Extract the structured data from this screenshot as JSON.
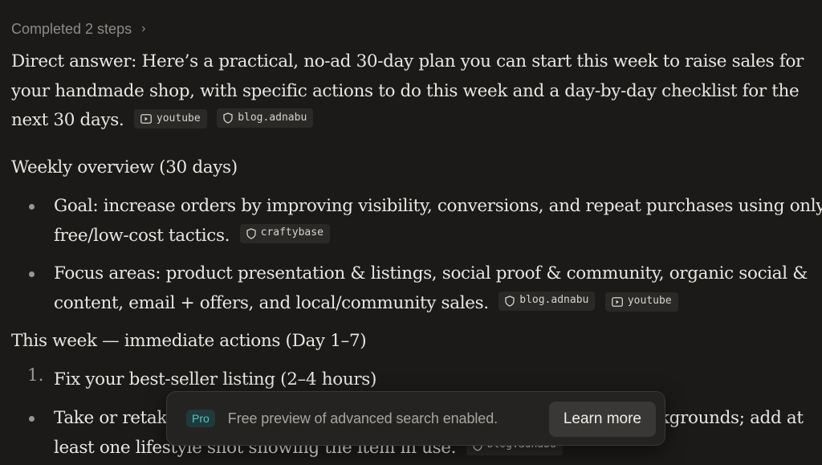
{
  "steps": {
    "label": "Completed 2 steps"
  },
  "intro": {
    "line1": "Direct answer: Here’s a practical, no-ad 30-day plan you can start this week to raise sales for",
    "line2": "your handmade shop, with specific actions to do this week and a day-by-day checklist for the",
    "line3": "next 30 days.",
    "citations": [
      "youtube",
      "blog.adnabu"
    ]
  },
  "weekly": {
    "heading": "Weekly overview (30 days)",
    "items": [
      {
        "line1": "Goal: increase orders by improving visibility, conversions, and repeat purchases using only",
        "line2": "free/low-cost tactics.",
        "citations": [
          "craftybase"
        ]
      },
      {
        "line1": "Focus areas: product presentation & listings, social proof & community, organic social &",
        "line2": "content, email + offers, and local/community sales.",
        "citations": [
          "blog.adnabu",
          "youtube"
        ]
      }
    ]
  },
  "thisweek": {
    "heading": "This week — immediate actions (Day 1–7)",
    "numbered": [
      {
        "number": "1.",
        "text": "Fix your best-seller listing (2–4 hours)"
      }
    ],
    "sub": {
      "line1_start": "Take or retak",
      "line1_end": "kgrounds; add at",
      "line2": "least one lifestyle shot showing the item in use.",
      "citations": [
        "blog.adnabu"
      ]
    }
  },
  "toast": {
    "badge": "Pro",
    "message": "Free preview of advanced search enabled.",
    "button": "Learn more"
  },
  "colors": {
    "background": "#1c1a19",
    "text": "#e8e6e1",
    "muted": "#8d8a85",
    "pro_accent": "#5cc2c4"
  },
  "icons": {
    "steps": "chevron-right-icon",
    "youtube": "play-icon",
    "web": "shield-icon"
  }
}
